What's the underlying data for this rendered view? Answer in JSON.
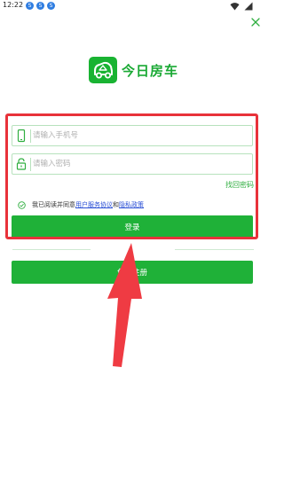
{
  "status_bar": {
    "time": "12:22",
    "notification_icons": [
      "S",
      "S",
      "S"
    ]
  },
  "login": {
    "app_name": "今日房车",
    "phone_placeholder": "请输入手机号",
    "password_placeholder": "请输入密码",
    "recover_password": "找回密码",
    "agreement": {
      "prefix": "我已阅读并同意",
      "user_agreement": "用户服务协议",
      "and": "和",
      "privacy_policy": "隐私政策"
    },
    "login_button": "登录",
    "divider_text": "",
    "register_button": "免费注册"
  },
  "colors": {
    "brand_green": "#1fb138",
    "highlight_red": "#e8323a",
    "link_blue": "#2a4fd6"
  },
  "icons": [
    "wifi-icon",
    "battery-icon",
    "close-icon",
    "camper-van-icon",
    "phone-icon",
    "lock-icon",
    "check-circle-icon",
    "arrow-annotation"
  ]
}
